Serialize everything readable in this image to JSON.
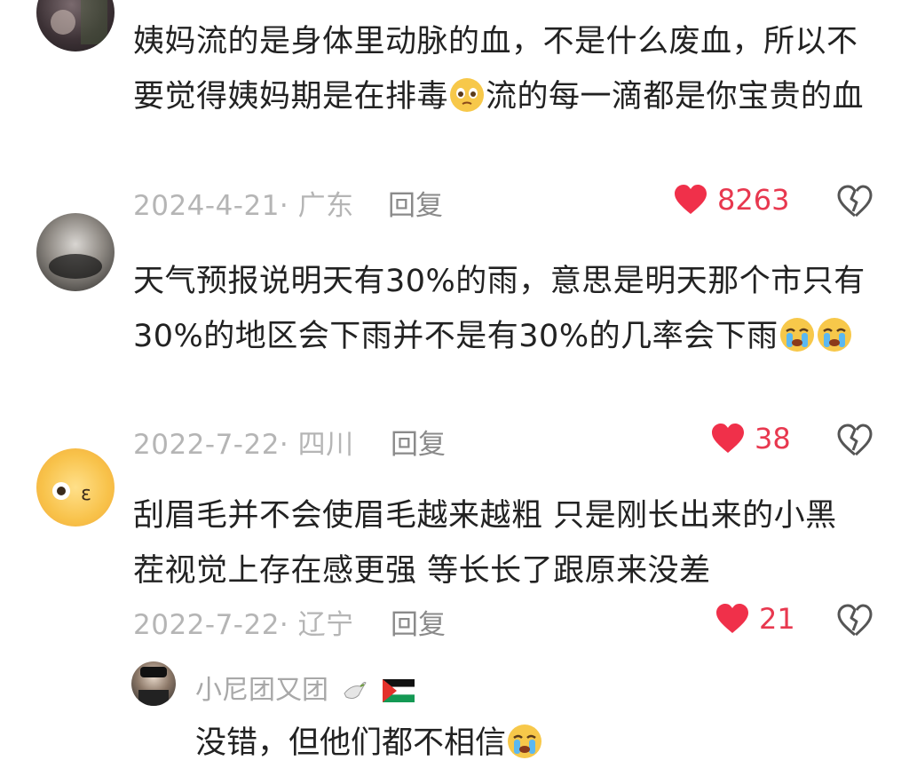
{
  "comments": [
    {
      "text": "姨妈流的是身体里动脉的血，不是什么废血，所以不要觉得姨妈期是在排毒",
      "text_after": "流的每一滴都是你宝贵的血",
      "date_location": "2024-4-21· 广东",
      "reply_label": "回复",
      "likes": "8263"
    },
    {
      "text": "天气预报说明天有30%的雨，意思是明天那个市只有30%的地区会下雨并不是有30%的几率会下雨",
      "date_location": "2022-7-22· 四川",
      "reply_label": "回复",
      "likes": "38"
    },
    {
      "text": "刮眉毛并不会使眉毛越来越粗 只是刚长出来的小黑茬视觉上存在感更强 等长长了跟原来没差",
      "date_location": "2022-7-22· 辽宁",
      "reply_label": "回复",
      "likes": "21"
    }
  ],
  "reply": {
    "username": "小尼团又团",
    "text": "没错，但他们都不相信"
  },
  "colors": {
    "heart": "#f0304a",
    "like_count": "#e8384f",
    "meta": "#b5b5b5"
  }
}
